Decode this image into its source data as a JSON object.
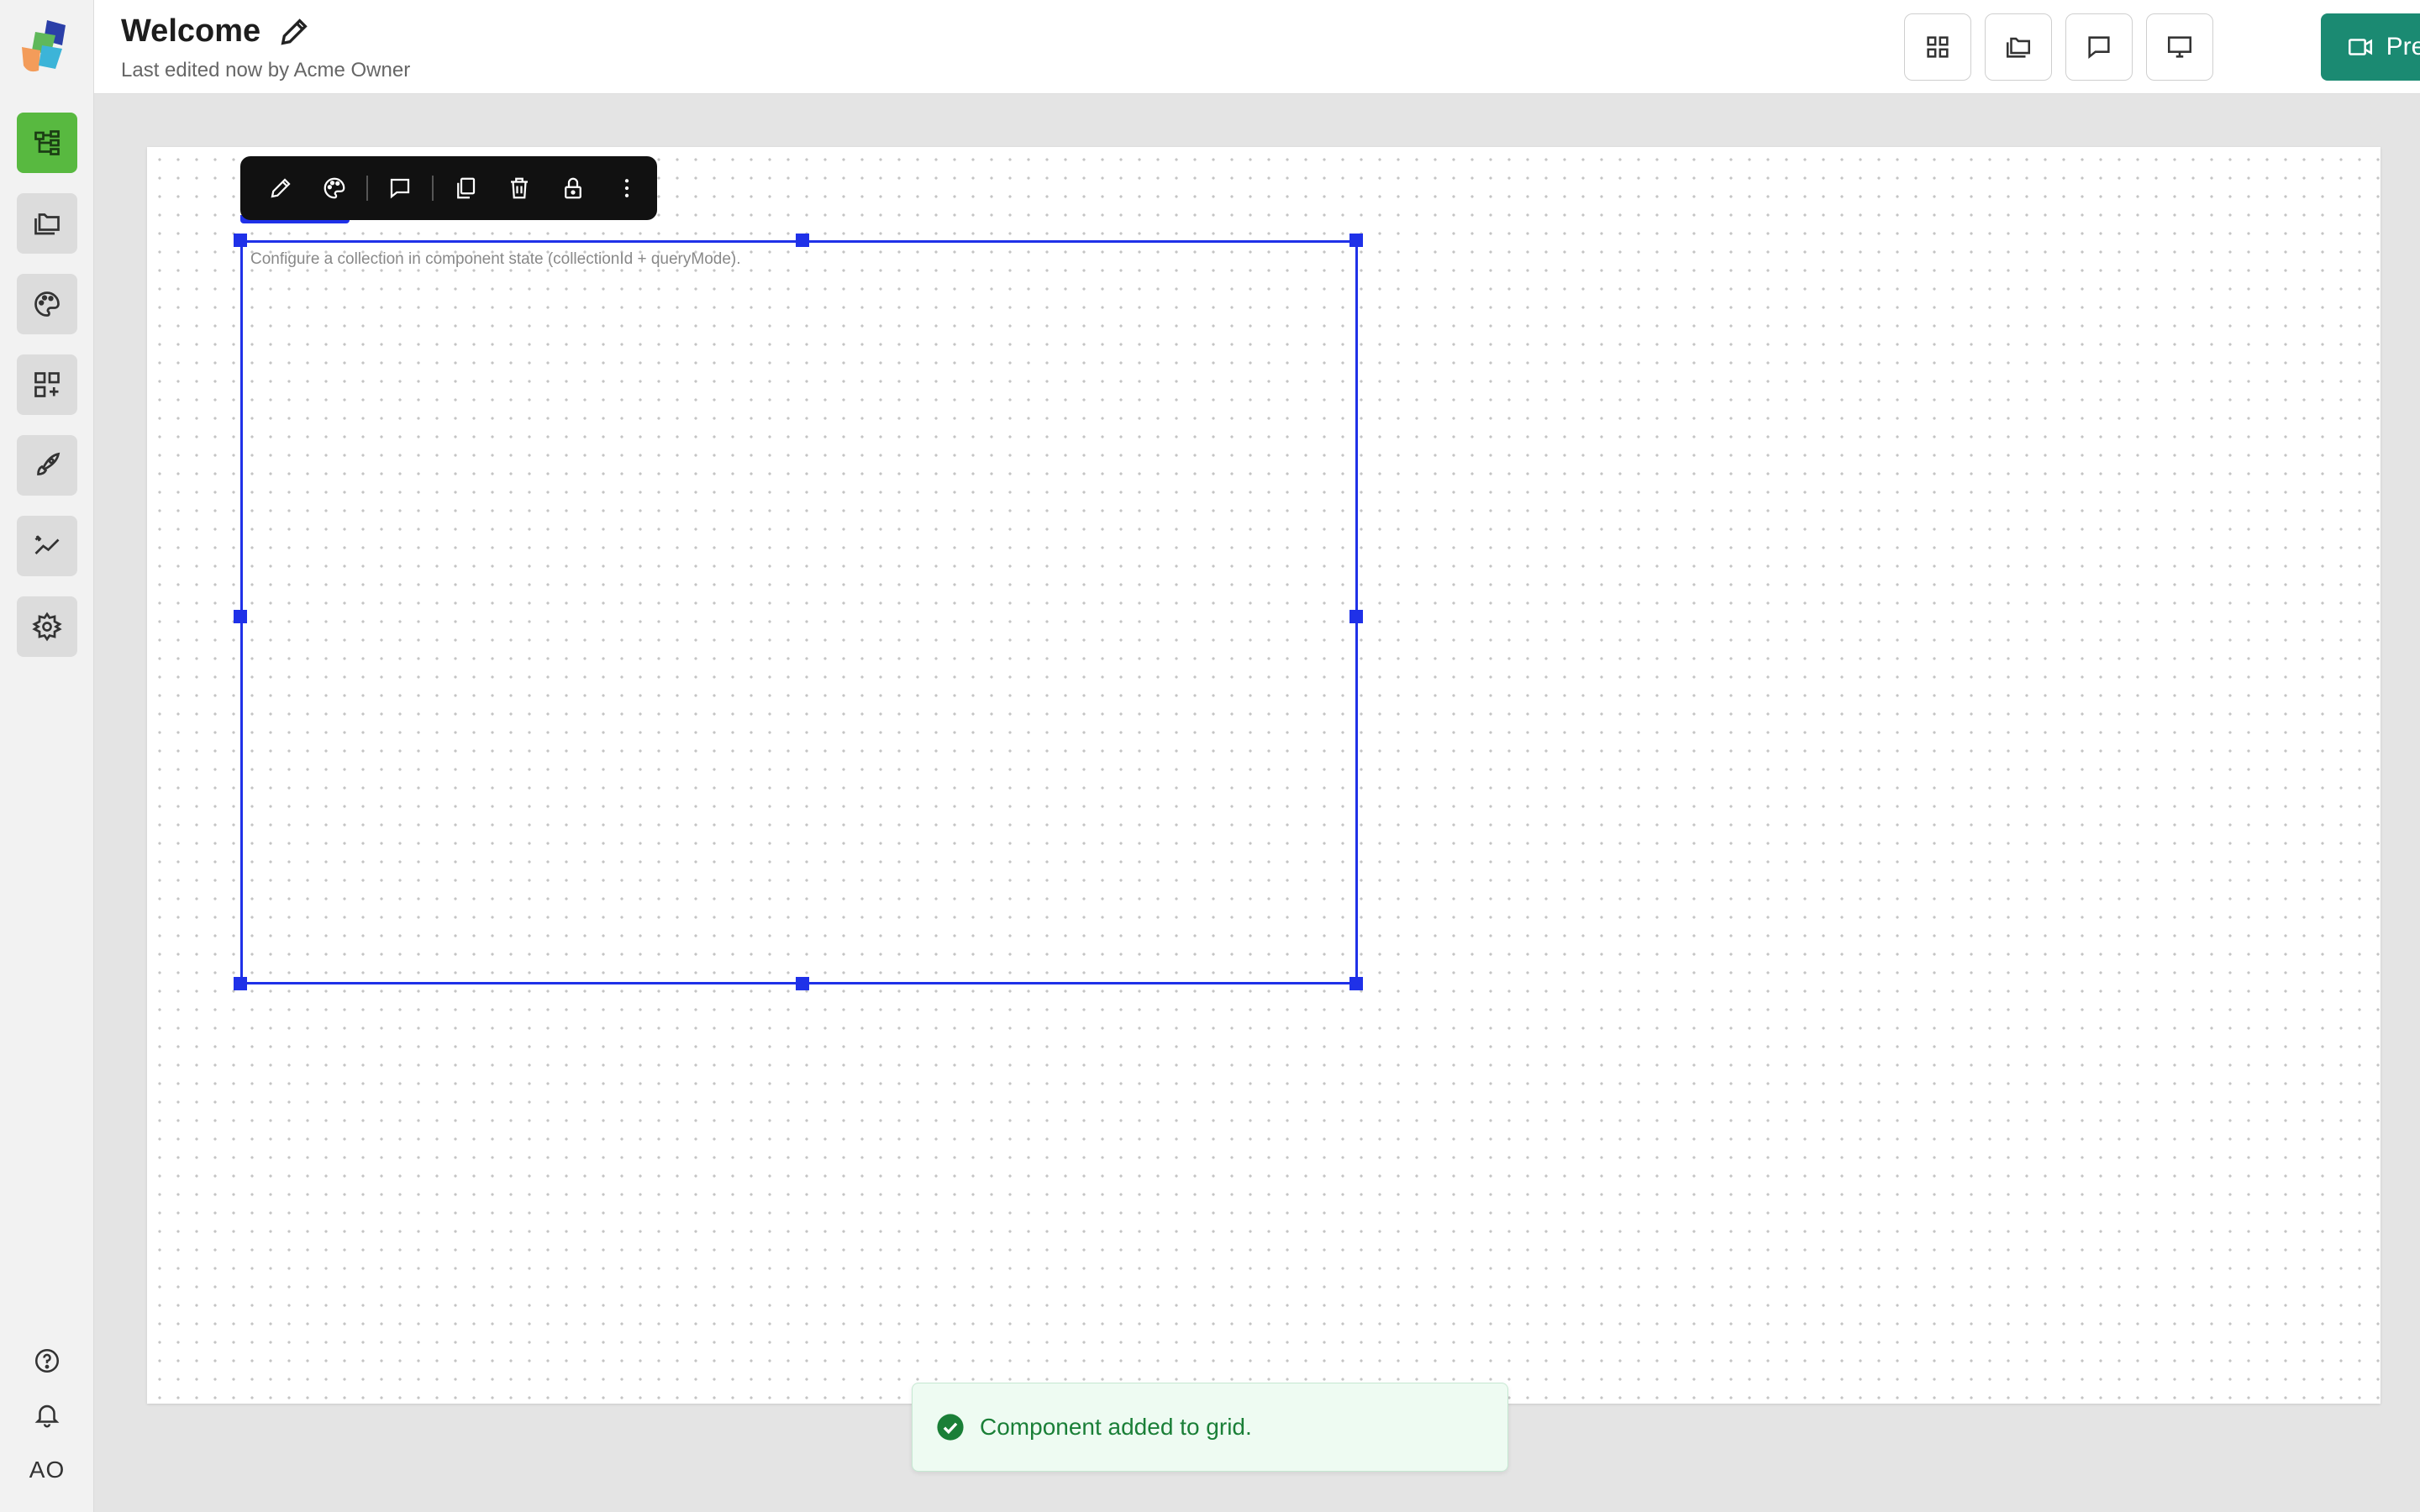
{
  "header": {
    "title": "Welcome",
    "subtitle": "Last edited now by Acme Owner",
    "preview_label": "Preview"
  },
  "sidebar": {
    "items": [
      {
        "icon": "component-tree-icon",
        "active": true
      },
      {
        "icon": "folders-icon",
        "active": false
      },
      {
        "icon": "palette-icon",
        "active": false
      },
      {
        "icon": "add-widget-icon",
        "active": false
      },
      {
        "icon": "rocket-icon",
        "active": false
      },
      {
        "icon": "analytics-icon",
        "active": false
      },
      {
        "icon": "settings-icon",
        "active": false
      }
    ],
    "bottom": {
      "help_icon": "help-icon",
      "notifications_icon": "bell-icon",
      "avatar_initials": "AO"
    }
  },
  "header_buttons": [
    "grid-icon",
    "folders-icon",
    "comment-icon",
    "monitor-icon"
  ],
  "toolbar": {
    "items": [
      "pencil-icon",
      "palette-icon",
      "comment-icon",
      "copy-icon",
      "trash-icon",
      "lock-icon",
      "more-vertical-icon"
    ]
  },
  "canvas": {
    "empty_message": "Configure a collection in component state (collectionId + queryMode)."
  },
  "toast": {
    "message": "Component added to grid."
  },
  "colors": {
    "accent": "#1b8a72",
    "active_rail": "#58b940",
    "selection": "#1f31e8",
    "toast_text": "#1a7f37"
  }
}
